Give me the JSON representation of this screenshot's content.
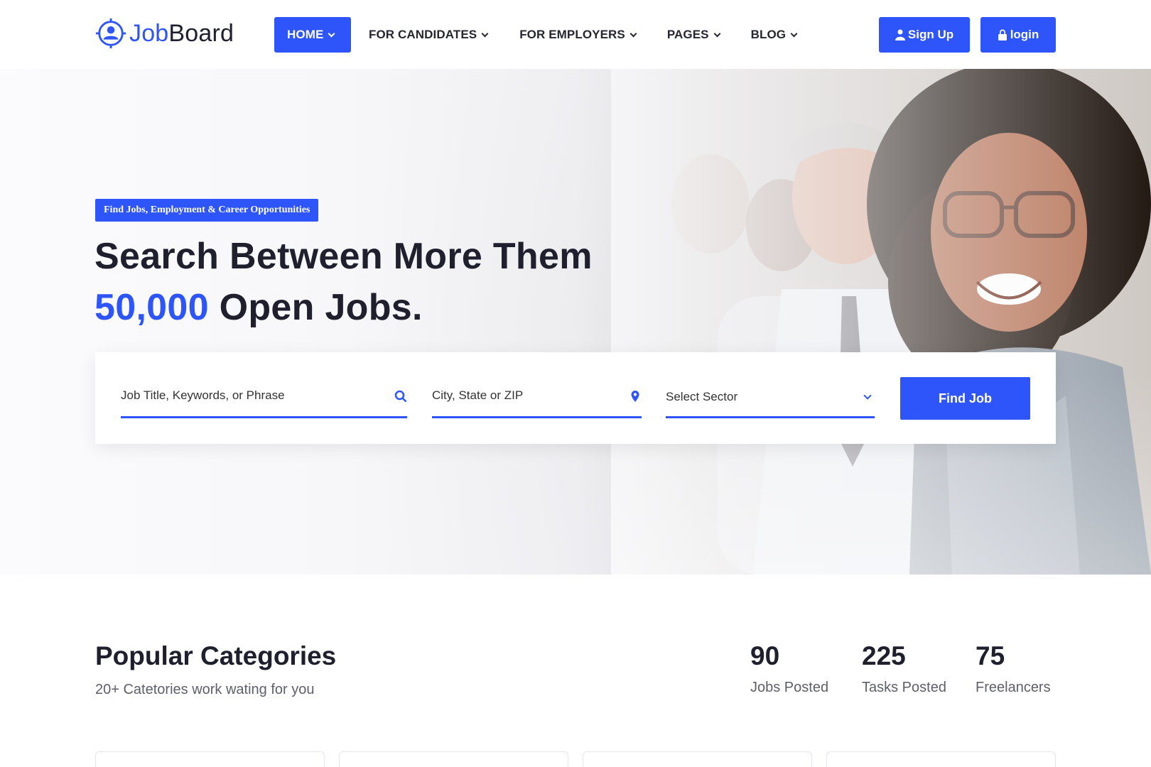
{
  "brand": {
    "name_part1": "Job",
    "name_part2": "Board",
    "accent": "#2e55fa"
  },
  "nav": {
    "items": [
      {
        "label": "HOME",
        "active": true
      },
      {
        "label": "FOR CANDIDATES"
      },
      {
        "label": "FOR EMPLOYERS"
      },
      {
        "label": "PAGES"
      },
      {
        "label": "BLOG"
      }
    ],
    "signup_label": "Sign Up",
    "login_label": "login"
  },
  "hero": {
    "badge": "Find Jobs, Employment & Career Opportunities",
    "headline_line1": "Search Between More Them",
    "headline_number": "50,000",
    "headline_rest": " Open Jobs."
  },
  "search": {
    "keyword_placeholder": "Job Title, Keywords, or Phrase",
    "location_placeholder": "City, State or ZIP",
    "sector_selected": "Select Sector",
    "button_label": "Find Job"
  },
  "categories": {
    "title": "Popular Categories",
    "subtitle": "20+ Catetories work wating for you"
  },
  "stats": [
    {
      "value": "90",
      "label": "Jobs Posted"
    },
    {
      "value": "225",
      "label": "Tasks Posted"
    },
    {
      "value": "75",
      "label": "Freelancers"
    }
  ]
}
